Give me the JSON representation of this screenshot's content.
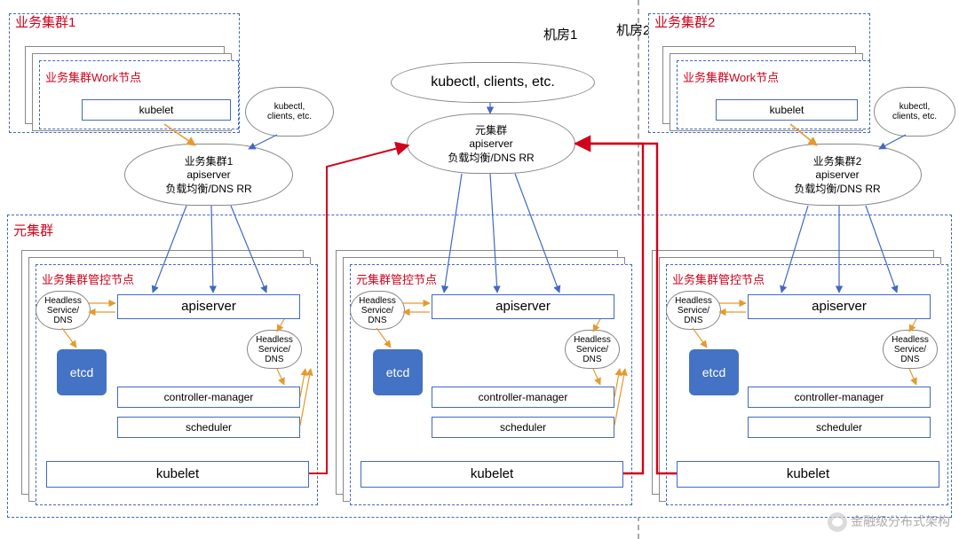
{
  "labels": {
    "room1": "机房1",
    "room2": "机房2",
    "biz_cluster1": "业务集群1",
    "biz_cluster2": "业务集群2",
    "meta_cluster": "元集群",
    "biz_work_node": "业务集群Work节点",
    "biz_ctrl_node": "业务集群管控节点",
    "meta_ctrl_node": "元集群管控节点",
    "kubelet": "kubelet",
    "apiserver": "apiserver",
    "controller_manager": "controller-manager",
    "scheduler": "scheduler",
    "etcd": "etcd",
    "kubectl_clients": "kubectl, clients, etc.",
    "kubectl_clients_short": "kubectl,\nclients, etc.",
    "headless_svc": "Headless\nService/\nDNS",
    "lb_biz1_l1": "业务集群1",
    "lb_biz1_l2": "apiserver",
    "lb_biz1_l3": "负载均衡/DNS RR",
    "lb_biz2_l1": "业务集群2",
    "lb_biz2_l2": "apiserver",
    "lb_biz2_l3": "负载均衡/DNS RR",
    "lb_meta_l1": "元集群",
    "lb_meta_l2": "apiserver",
    "lb_meta_l3": "负载均衡/DNS RR",
    "watermark": "金融级分布式架构"
  }
}
